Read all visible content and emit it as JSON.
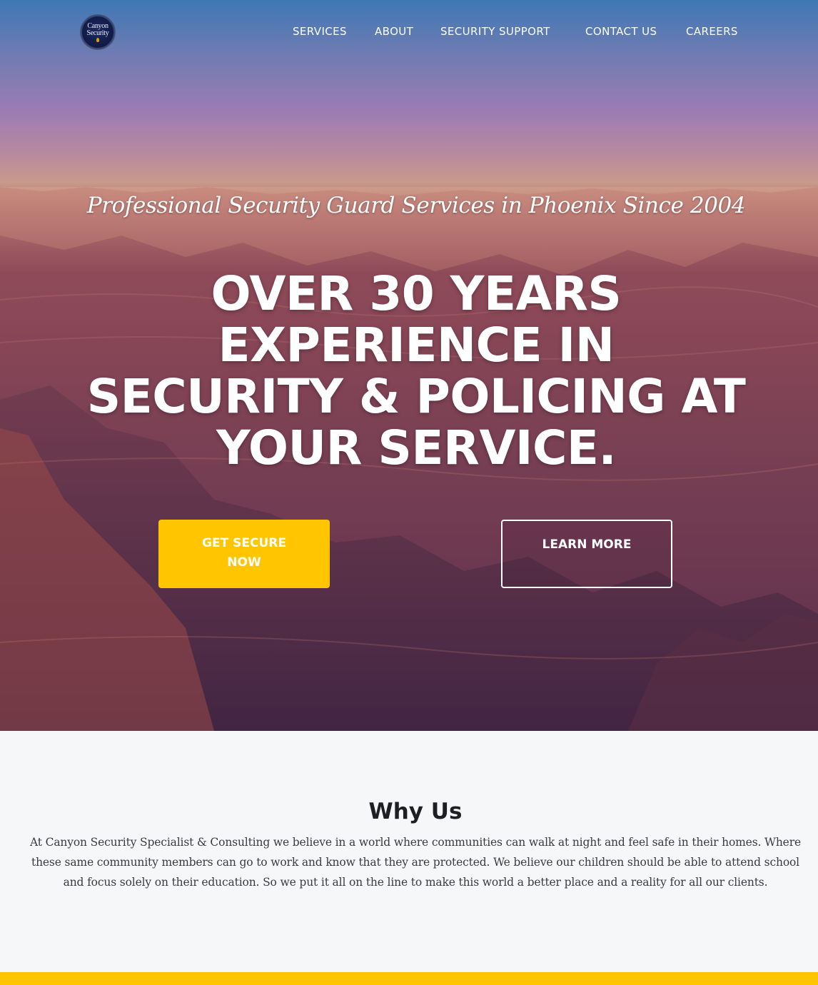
{
  "logo": {
    "line1": "Canyon",
    "line2": "Security"
  },
  "nav": {
    "items": [
      {
        "label": "SERVICES"
      },
      {
        "label": "ABOUT"
      },
      {
        "label": "SECURITY SUPPORT"
      },
      {
        "label": "CONTACT US"
      },
      {
        "label": "CAREERS"
      }
    ]
  },
  "hero": {
    "tagline": "Professional Security Guard Services in Phoenix Since 2004",
    "headline": "OVER 30 YEARS EXPERIENCE IN SECURITY & POLICING AT YOUR SERVICE.",
    "primary_button": "GET SECURE NOW",
    "secondary_button": "LEARN MORE"
  },
  "why": {
    "title": "Why Us",
    "body": "At Canyon Security Specialist & Consulting we believe in a world where communities can walk at night and feel safe in their homes. Where these same community members can go to work and know that they are protected. We believe our children should be able to attend school and focus solely on their education. So we put it all on the line to make this world a better place and a reality for all our clients."
  },
  "colors": {
    "accent_yellow": "#ffc600",
    "page_background": "#f6f7f9",
    "heading_text": "#1e1e24",
    "body_text": "#3a3a40"
  }
}
